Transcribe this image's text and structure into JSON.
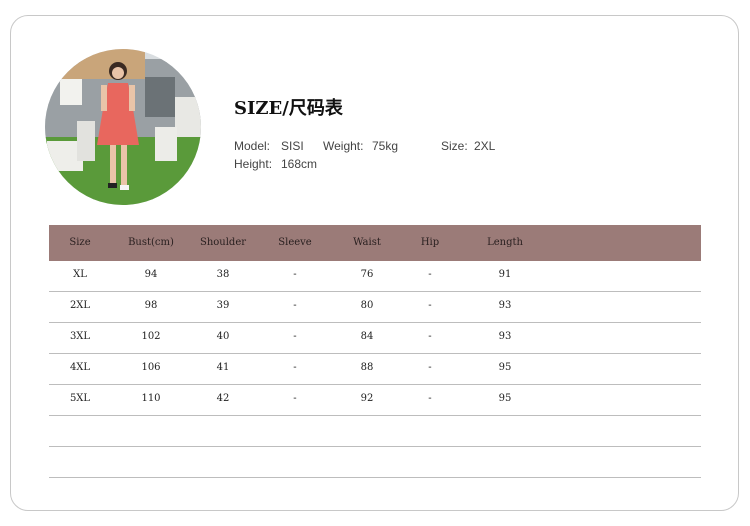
{
  "title": "SIZE/尺码表",
  "model": {
    "model_label": "Model:",
    "model_value": "SISI",
    "weight_label": "Weight:",
    "weight_value": "75kg",
    "size_label": "Size:",
    "size_value": "2XL",
    "height_label": "Height:",
    "height_value": "168cm"
  },
  "table": {
    "headers": [
      "Size",
      "Bust(cm)",
      "Shoulder",
      "Sleeve",
      "Waist",
      "Hip",
      "Length"
    ],
    "rows": [
      [
        "XL",
        "94",
        "38",
        "-",
        "76",
        "-",
        "91"
      ],
      [
        "2XL",
        "98",
        "39",
        "-",
        "80",
        "-",
        "93"
      ],
      [
        "3XL",
        "102",
        "40",
        "-",
        "84",
        "-",
        "93"
      ],
      [
        "4XL",
        "106",
        "41",
        "-",
        "88",
        "-",
        "95"
      ],
      [
        "5XL",
        "110",
        "42",
        "-",
        "92",
        "-",
        "95"
      ],
      [
        "",
        "",
        "",
        "",
        "",
        "",
        ""
      ],
      [
        "",
        "",
        "",
        "",
        "",
        "",
        ""
      ]
    ]
  },
  "colors": {
    "header_bg": "#9b7b78",
    "dress": "#e8675e",
    "grass": "#5a9a3a"
  }
}
